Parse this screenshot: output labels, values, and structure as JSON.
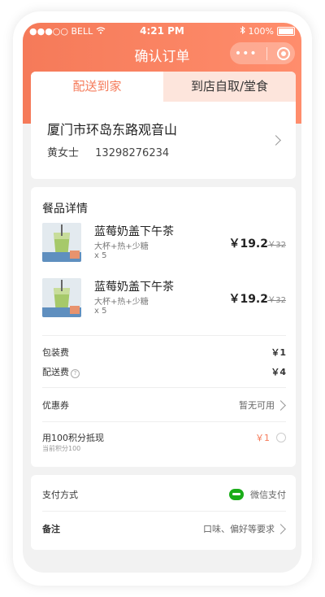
{
  "status_bar": {
    "carrier": "●●●○○ BELL",
    "time": "4:21 PM",
    "battery": "100%"
  },
  "nav": {
    "title": "确认订单",
    "more_label": "•••"
  },
  "delivery_tabs": [
    {
      "label": "配送到家",
      "active": true
    },
    {
      "label": "到店自取/堂食",
      "active": false
    }
  ],
  "address": {
    "line": "厦门市环岛东路观音山",
    "name": "黄女士",
    "phone": "13298276234"
  },
  "order": {
    "section_title": "餐品详情",
    "items": [
      {
        "name": "蓝莓奶盖下午茶",
        "spec": "大杯+热+少糖",
        "qty": "x 5",
        "price": "￥19.2",
        "original_price": "￥32"
      },
      {
        "name": "蓝莓奶盖下午茶",
        "spec": "大杯+热+少糖",
        "qty": "x 5",
        "price": "￥19.2",
        "original_price": "￥32"
      }
    ],
    "packing_fee_label": "包装费",
    "packing_fee": "￥1",
    "delivery_fee_label": "配送费",
    "delivery_fee": "￥4",
    "coupon_label": "优惠券",
    "coupon_value": "暂无可用",
    "points_label": "用100积分抵现",
    "points_sub": "当前积分100",
    "points_value": "￥1"
  },
  "payment": {
    "method_label": "支付方式",
    "method_value": "微信支付",
    "note_label": "备注",
    "note_placeholder": "口味、偏好等要求"
  },
  "colors": {
    "accent": "#f57a59",
    "tab_inactive_bg": "#fde5dc",
    "wechat_green": "#1aad19"
  }
}
